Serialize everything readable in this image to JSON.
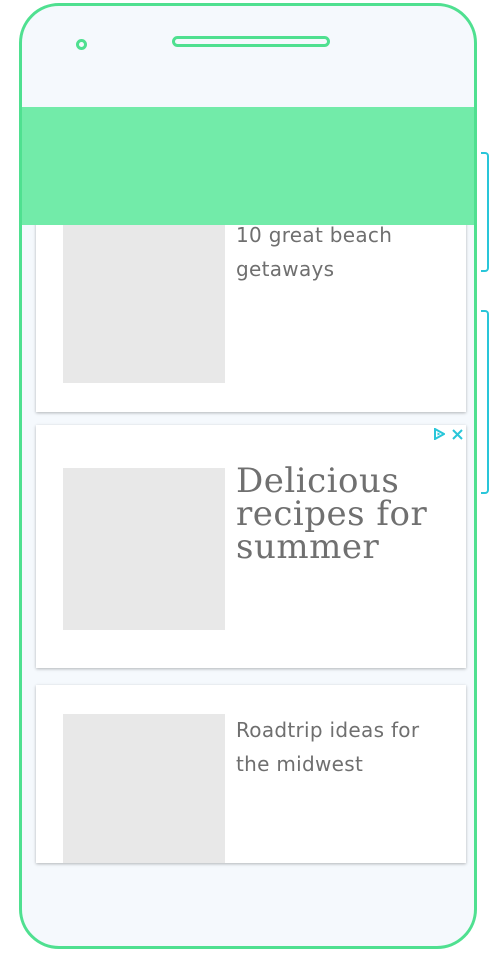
{
  "articles": [
    {
      "title": "10 great beach getaways"
    },
    {
      "title": "Delicious recipes for summer",
      "is_ad": true
    },
    {
      "title": "Roadtrip ideas for the midwest"
    }
  ],
  "icons": {
    "ad_choices": "ad-choices-icon",
    "ad_close": "close-icon"
  },
  "colors": {
    "frame": "#4fe090",
    "app_bar": "#72eba9",
    "side_buttons": "#29c6d9",
    "ad_icon": "#29c6d9",
    "screen_bg": "#f5f9fd",
    "thumb": "#e8e8e8",
    "text": "#6f6f6f"
  }
}
